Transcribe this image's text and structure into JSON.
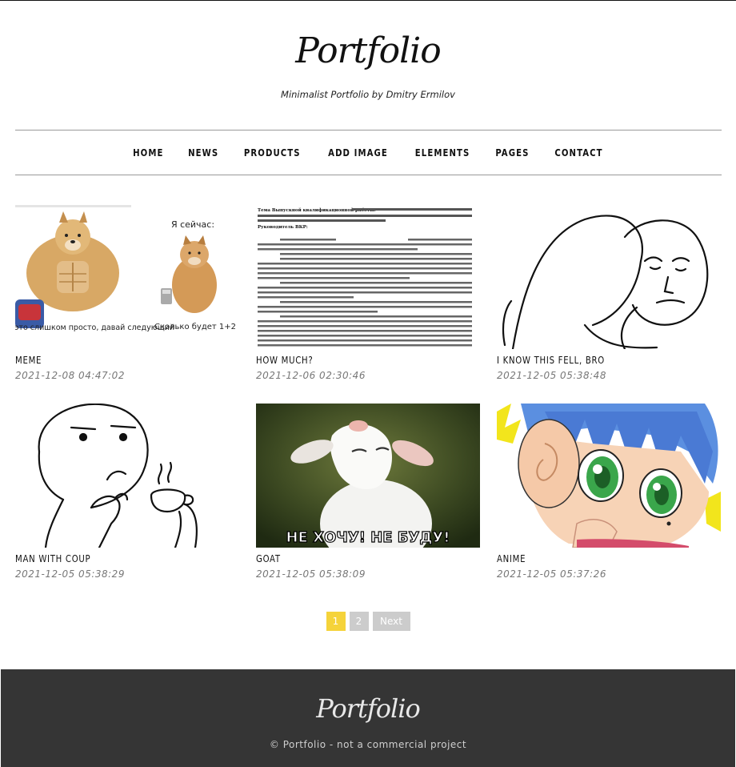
{
  "header": {
    "logo": "Portfolio",
    "tagline": "Minimalist Portfolio by Dmitry Ermilov"
  },
  "nav": {
    "items": [
      "HOME",
      "NEWS",
      "PRODUCTS",
      "ADD IMAGE",
      "ELEMENTS",
      "PAGES",
      "CONTACT"
    ]
  },
  "posts": [
    {
      "title": "MEME",
      "date": "2021-12-08 04:47:02",
      "image_text": [
        "Я сейчас:",
        "Деление – это слишком просто, давай следующий",
        "Сколько будет 1+2"
      ]
    },
    {
      "title": "HOW MUCH?",
      "date": "2021-12-06 02:30:46",
      "image_text": [
        "Тема Выпускной квалификационной работы:",
        "Руководитель ВКР:"
      ]
    },
    {
      "title": "I KNOW THIS FELL, BRO",
      "date": "2021-12-05 05:38:48"
    },
    {
      "title": "MAN WITH COUP",
      "date": "2021-12-05 05:38:29"
    },
    {
      "title": "GOAT",
      "date": "2021-12-05 05:38:09",
      "image_text": [
        "НЕ ХОЧУ! НЕ БУДУ!"
      ]
    },
    {
      "title": "ANIME",
      "date": "2021-12-05 05:37:26"
    }
  ],
  "pagination": {
    "pages": [
      "1",
      "2"
    ],
    "current": "1",
    "next_label": "Next"
  },
  "footer": {
    "logo": "Portfolio",
    "copyright": "© Portfolio - not a commercial project"
  },
  "colors": {
    "accent": "#f5d33a",
    "footer_bg": "#353535",
    "pagination_inactive": "#cccccc"
  }
}
